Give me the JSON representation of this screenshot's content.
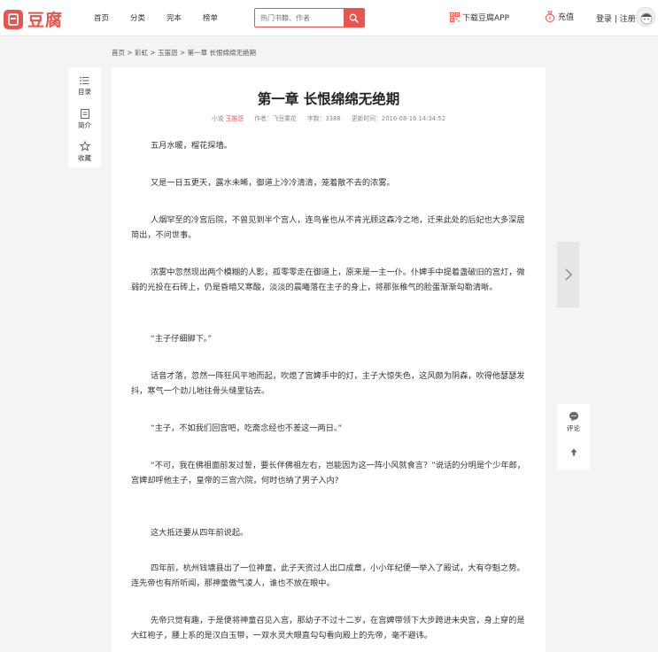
{
  "header": {
    "logo_text": "豆腐",
    "nav": [
      "首页",
      "分类",
      "完本",
      "榜单"
    ],
    "search_placeholder": "热门书籍、作者",
    "app_download": "下载豆腐APP",
    "recharge": "充值",
    "login": "登录 | 注册"
  },
  "breadcrumb": "首页 > 彩虹 > 玉笛怨 > 第一章 长恨绵绵无绝期",
  "left_tools": {
    "toc": "目录",
    "intro": "简介",
    "favorite": "收藏"
  },
  "chapter": {
    "title": "第一章 长恨绵绵无绝期",
    "meta": {
      "novel_label": "小说",
      "novel_name": "玉笛怨",
      "author": "作者：飞豆雾花",
      "words": "字数：3388",
      "updated": "更新时间：2016-08-16 14:34:52"
    },
    "paragraphs": [
      "五月水暖，榴花探墙。",
      "又是一日五更天，露水未晞，御道上冷冷清清，笼着散不去的浓雾。",
      "人烟罕至的冷宫后院，不曾见到半个宫人，连鸟雀也从不肯光顾这森冷之地，迁来此处的后妃也大多深居简出，不问世事。",
      "浓雾中忽然现出两个模糊的人影，孤零零走在御道上，原来是一主一仆。仆婢手中提着盏破旧的宫灯，微弱的光投在石砖上，仍是昏暗又寒酸，淡淡的晨曦落在主子的身上，将那张稚气的脸蛋渐渐勾勒清晰。",
      "“主子仔细脚下。”",
      "话音才落，忽然一阵狂风平地而起，吹熄了宫婢手中的灯，主子大惊失色，这风颇为阴森，吹得他瑟瑟发抖，寒气一个劲儿地往骨头缝里钻去。",
      "“主子，不如我们回宫吧，吃斋念经也不差这一两日。”",
      "“不可，我在佛祖面前发过誓，要长伴佛祖左右，岂能因为这一阵小风就食言？”说话的分明是个少年郎，宫婢却呼他主子，皇帝的三宫六院，何时也纳了男子入内?",
      "这大抵还要从四年前说起。",
      "四年前，杭州钱塘县出了一位神童，此子天资过人出口成章，小小年纪便一举入了殿试，大有夺魁之势。连先帝也有所听闻，那神童傲气凌人，谁也不放在眼中。",
      "先帝只觉有趣，于是便将神童召见入宫，那幼子不过十二岁，在宫婢带领下大步跨进未央宫，身上穿的是大红袍子，腰上系的是汉白玉带，一双水灵大眼直勾勾看向殿上的先帝，毫不避讳。"
    ]
  },
  "right_tools": {
    "comment": "评论"
  }
}
